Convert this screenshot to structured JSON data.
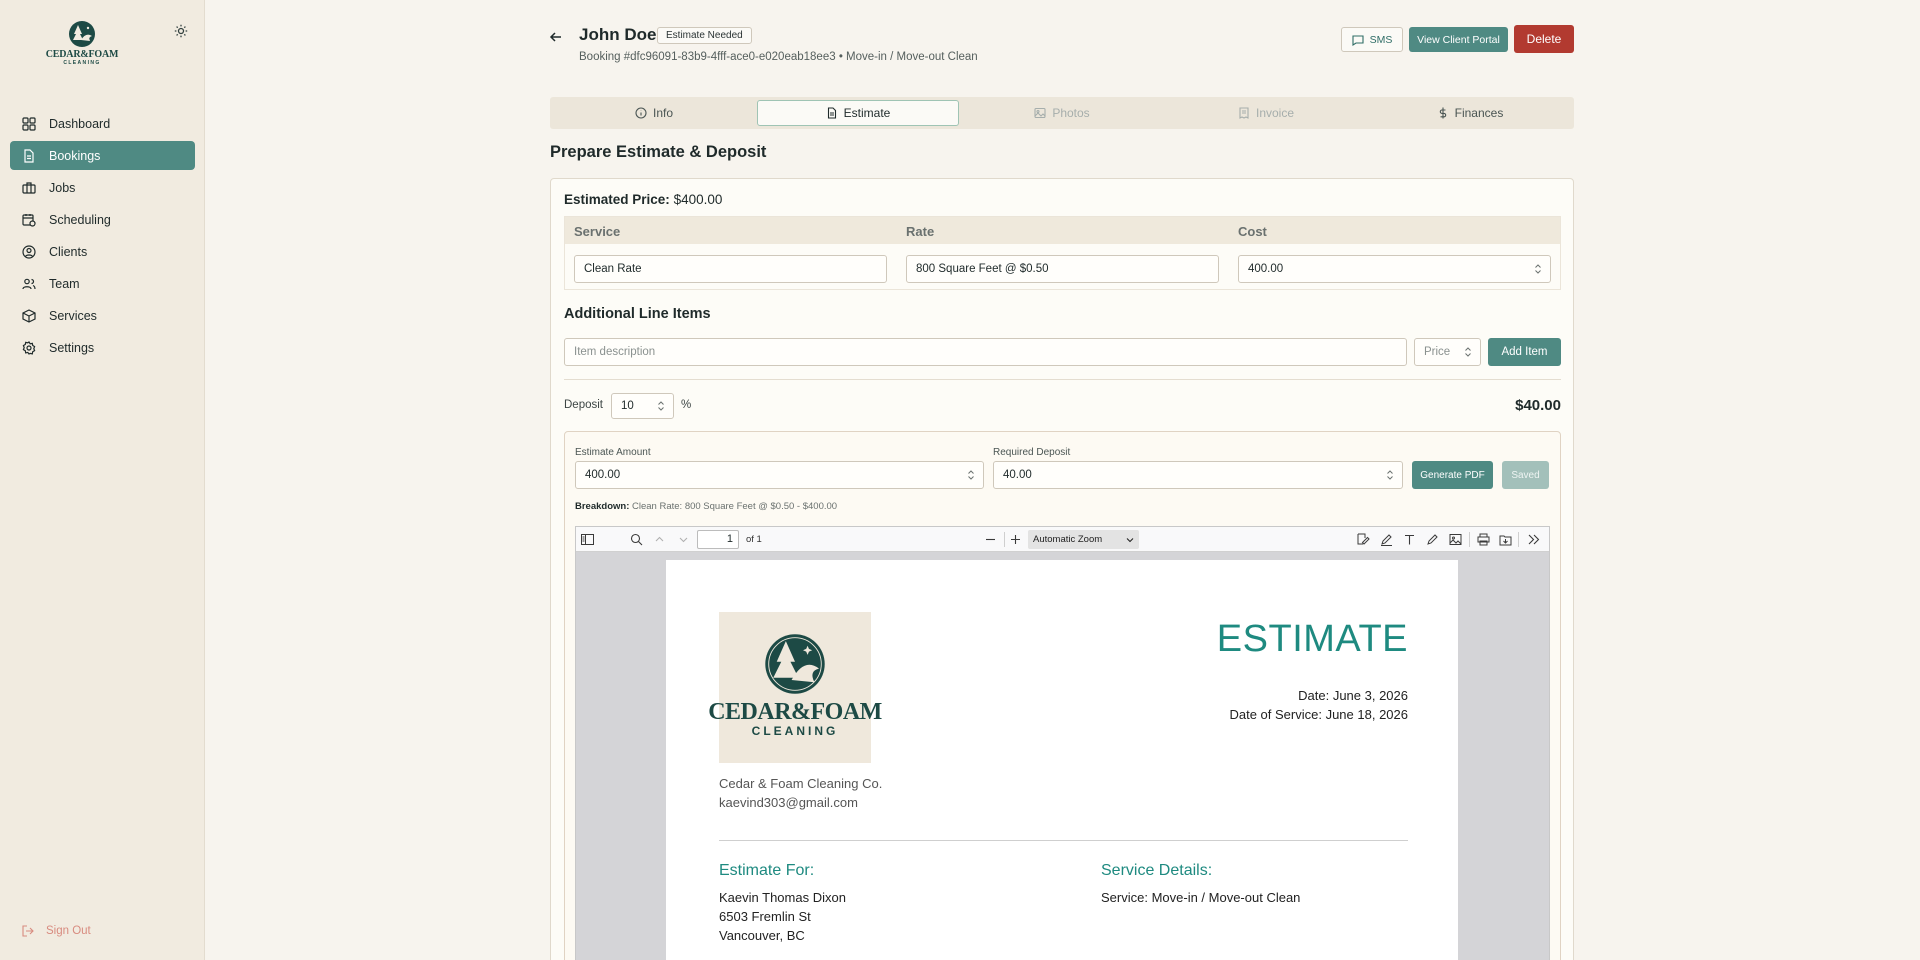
{
  "brand": {
    "logo_line1": "CEDAR&FOAM",
    "logo_line2": "CLEANING"
  },
  "sidebar": {
    "items": [
      {
        "label": "Dashboard",
        "icon": "dashboard-icon"
      },
      {
        "label": "Bookings",
        "icon": "document-icon"
      },
      {
        "label": "Jobs",
        "icon": "briefcase-icon"
      },
      {
        "label": "Scheduling",
        "icon": "calendar-clock-icon"
      },
      {
        "label": "Clients",
        "icon": "user-circle-icon"
      },
      {
        "label": "Team",
        "icon": "users-icon"
      },
      {
        "label": "Services",
        "icon": "package-icon"
      },
      {
        "label": "Settings",
        "icon": "gear-icon"
      }
    ],
    "active_index": 1,
    "sign_out": "Sign Out"
  },
  "header": {
    "client_name": "John Doe",
    "status": "Estimate Needed",
    "subtitle": "Booking #dfc96091-83b9-4fff-ace0-e020eab18ee3 • Move-in / Move-out Clean",
    "sms_label": "SMS",
    "portal_label": "View Client Portal",
    "delete_label": "Delete"
  },
  "tabs": [
    {
      "label": "Info",
      "state": "normal"
    },
    {
      "label": "Estimate",
      "state": "active"
    },
    {
      "label": "Photos",
      "state": "disabled"
    },
    {
      "label": "Invoice",
      "state": "disabled"
    },
    {
      "label": "Finances",
      "state": "normal"
    }
  ],
  "estimate": {
    "section_title": "Prepare Estimate & Deposit",
    "price_label": "Estimated Price:",
    "price_value": "$400.00",
    "table": {
      "headers": [
        "Service",
        "Rate",
        "Cost"
      ],
      "row": {
        "service": "Clean Rate",
        "rate": "800 Square Feet @ $0.50",
        "cost": "400.00"
      }
    },
    "additional_title": "Additional Line Items",
    "item_placeholder": "Item description",
    "price_placeholder": "Price",
    "add_item_label": "Add Item",
    "deposit_label": "Deposit",
    "deposit_percent": "10",
    "percent_sign": "%",
    "deposit_total": "$40.00",
    "estimate_amount_label": "Estimate Amount",
    "estimate_amount": "400.00",
    "required_deposit_label": "Required Deposit",
    "required_deposit": "40.00",
    "generate_pdf_label": "Generate PDF",
    "saved_label": "Saved",
    "breakdown_label": "Breakdown:",
    "breakdown_text": "Clean Rate: 800 Square Feet @ $0.50 - $400.00"
  },
  "pdf_viewer": {
    "page_number": "1",
    "page_of": "of 1",
    "zoom": "Automatic Zoom",
    "doc": {
      "title": "ESTIMATE",
      "date": "Date: June 3, 2026",
      "service_date": "Date of Service: June 18, 2026",
      "company_name": "Cedar & Foam Cleaning Co.",
      "company_email": "kaevind303@gmail.com",
      "estimate_for_heading": "Estimate For:",
      "client_name": "Kaevin Thomas Dixon",
      "client_street": "6503 Fremlin St",
      "client_city": "Vancouver, BC",
      "service_details_heading": "Service Details:",
      "service_line": "Service: Move-in / Move-out Clean"
    }
  },
  "colors": {
    "accent": "#4f8a83",
    "danger": "#b23a30",
    "pdf_teal": "#1e8a80",
    "background": "#f7f4ee"
  }
}
